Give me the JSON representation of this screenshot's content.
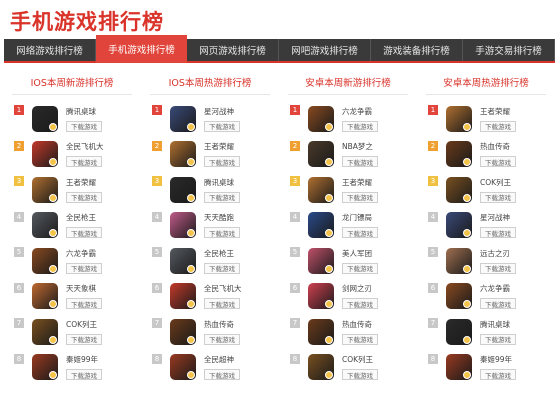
{
  "title": "手机游戏排行榜",
  "nav": {
    "tabs": [
      "网络游戏排行榜",
      "手机游戏排行榜",
      "网页游戏排行榜",
      "网吧游戏排行榜",
      "游戏装备排行榜",
      "手游交易排行榜"
    ],
    "active_index": 1
  },
  "download_label": "下载游戏",
  "columns": [
    {
      "title": "IOS本周新游排行榜",
      "items": [
        {
          "rank": "1",
          "name": "腾讯桌球",
          "icon": "game-icon-billiards",
          "color": "#2a2a2a"
        },
        {
          "rank": "2",
          "name": "全民飞机大",
          "icon": "game-icon-planes",
          "color": "#c43a2a"
        },
        {
          "rank": "3",
          "name": "王者荣耀",
          "icon": "game-icon-hero",
          "color": "#b07030"
        },
        {
          "rank": "4",
          "name": "全民枪王",
          "icon": "game-icon-gunner",
          "color": "#555a60"
        },
        {
          "rank": "5",
          "name": "六龙争霸",
          "icon": "game-icon-dragon",
          "color": "#8a4a20"
        },
        {
          "rank": "6",
          "name": "天天象棋",
          "icon": "game-icon-chess",
          "color": "#c06a30"
        },
        {
          "rank": "7",
          "name": "COK列王",
          "icon": "game-icon-cok",
          "color": "#7a5020"
        },
        {
          "rank": "8",
          "name": "秦姬99年",
          "icon": "game-icon-warrior",
          "color": "#9a3a20"
        }
      ]
    },
    {
      "title": "IOS本周热游排行榜",
      "items": [
        {
          "rank": "1",
          "name": "星河战神",
          "icon": "game-icon-mech",
          "color": "#3a4a7a"
        },
        {
          "rank": "2",
          "name": "王者荣耀",
          "icon": "game-icon-hero",
          "color": "#b07030"
        },
        {
          "rank": "3",
          "name": "腾讯桌球",
          "icon": "game-icon-billiards",
          "color": "#2a2a2a"
        },
        {
          "rank": "4",
          "name": "天天酷跑",
          "icon": "game-icon-runner",
          "color": "#c05a8a"
        },
        {
          "rank": "5",
          "name": "全民枪王",
          "icon": "game-icon-gunner",
          "color": "#555a60"
        },
        {
          "rank": "6",
          "name": "全民飞机大",
          "icon": "game-icon-planes",
          "color": "#c43a2a"
        },
        {
          "rank": "7",
          "name": "热血传奇",
          "icon": "game-icon-legend",
          "color": "#6a3a1a"
        },
        {
          "rank": "8",
          "name": "全民超神",
          "icon": "game-icon-warrior",
          "color": "#9a3a20"
        }
      ]
    },
    {
      "title": "安卓本周新游排行榜",
      "items": [
        {
          "rank": "1",
          "name": "六龙争霸",
          "icon": "game-icon-dragon",
          "color": "#8a4a20"
        },
        {
          "rank": "2",
          "name": "NBA梦之",
          "icon": "game-icon-nba",
          "color": "#4a3a2a"
        },
        {
          "rank": "3",
          "name": "王者荣耀",
          "icon": "game-icon-hero",
          "color": "#b07030"
        },
        {
          "rank": "4",
          "name": "龙门镖局",
          "icon": "game-icon-dragon-gold",
          "color": "#2a4a8a"
        },
        {
          "rank": "5",
          "name": "美人军团",
          "icon": "game-icon-beauty",
          "color": "#c0506a"
        },
        {
          "rank": "6",
          "name": "剑网之刃",
          "icon": "game-icon-blade",
          "color": "#d04050"
        },
        {
          "rank": "7",
          "name": "热血传奇",
          "icon": "game-icon-legend",
          "color": "#6a3a1a"
        },
        {
          "rank": "8",
          "name": "COK列王",
          "icon": "game-icon-cok",
          "color": "#7a5020"
        }
      ]
    },
    {
      "title": "安卓本周热游排行榜",
      "items": [
        {
          "rank": "1",
          "name": "王者荣耀",
          "icon": "game-icon-hero",
          "color": "#b07030"
        },
        {
          "rank": "2",
          "name": "热血传奇",
          "icon": "game-icon-legend",
          "color": "#6a3a1a"
        },
        {
          "rank": "3",
          "name": "COK列王",
          "icon": "game-icon-cok",
          "color": "#7a5020"
        },
        {
          "rank": "4",
          "name": "星河战神",
          "icon": "game-icon-mech",
          "color": "#3a4a7a"
        },
        {
          "rank": "5",
          "name": "远古之刃",
          "icon": "game-icon-ancient",
          "color": "#a07050"
        },
        {
          "rank": "6",
          "name": "六龙争霸",
          "icon": "game-icon-dragon",
          "color": "#8a4a20"
        },
        {
          "rank": "7",
          "name": "腾讯桌球",
          "icon": "game-icon-billiards",
          "color": "#2a2a2a"
        },
        {
          "rank": "8",
          "name": "秦姬99年",
          "icon": "game-icon-warrior",
          "color": "#9a3a20"
        }
      ]
    }
  ]
}
